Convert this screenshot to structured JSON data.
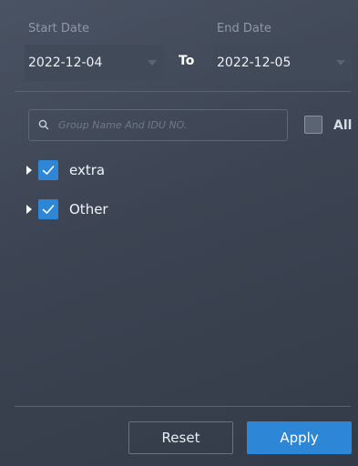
{
  "dates": {
    "start_label": "Start Date",
    "start_value": "2022-12-04",
    "to_label": "To",
    "end_label": "End Date",
    "end_value": "2022-12-05"
  },
  "search": {
    "placeholder": "Group Name And IDU NO.",
    "value": ""
  },
  "select_all": {
    "label": "All",
    "checked": false
  },
  "tree": {
    "items": [
      {
        "label": "extra",
        "checked": true,
        "expanded": false
      },
      {
        "label": "Other",
        "checked": true,
        "expanded": false
      }
    ]
  },
  "footer": {
    "reset_label": "Reset",
    "apply_label": "Apply"
  },
  "colors": {
    "accent": "#2e86d6",
    "panel_bg": "#3c4453"
  },
  "icons": {
    "search": "search-icon",
    "checkmark": "check-icon",
    "expand": "caret-right-icon",
    "dropdown": "chevron-down-icon"
  }
}
